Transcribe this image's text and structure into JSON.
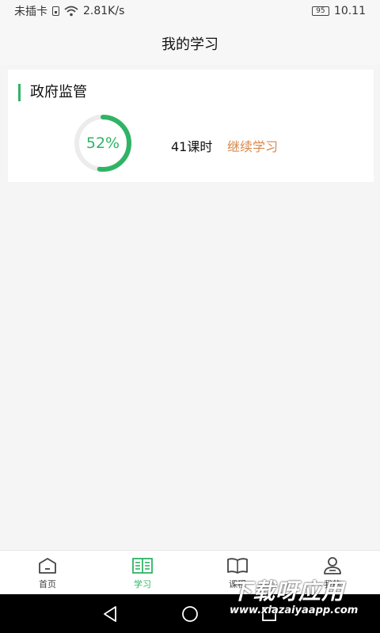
{
  "status_bar": {
    "carrier": "未插卡",
    "speed": "2.81K/s",
    "battery": "95",
    "time": "10.11"
  },
  "header": {
    "title": "我的学习"
  },
  "course_card": {
    "title": "政府监管",
    "progress": 52,
    "progress_label": "52%",
    "hours": "41课时",
    "continue_label": "继续学习"
  },
  "tabbar": {
    "items": [
      {
        "label": "首页",
        "icon": "home-icon",
        "active": false
      },
      {
        "label": "学习",
        "icon": "study-book-icon",
        "active": true
      },
      {
        "label": "课程",
        "icon": "open-book-icon",
        "active": false
      },
      {
        "label": "我的",
        "icon": "user-icon",
        "active": false
      }
    ]
  },
  "watermark": {
    "text": "下载呀应用",
    "url": "www.xiazaiyaapp.com"
  },
  "colors": {
    "accent": "#2fb465",
    "continue": "#d9874a"
  }
}
